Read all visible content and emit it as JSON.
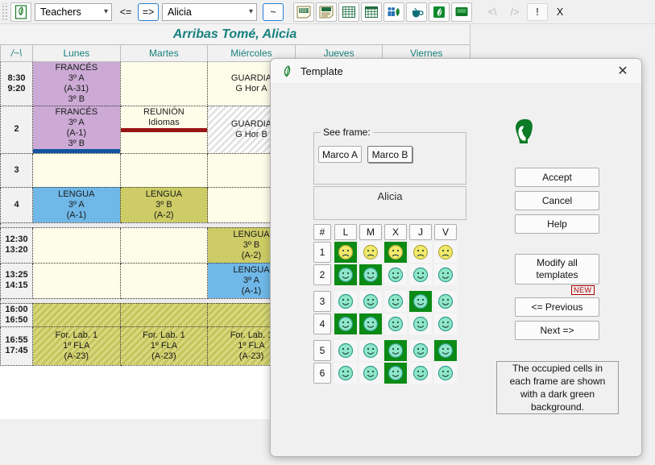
{
  "toolbar": {
    "app_icon": "leaf-door-icon",
    "entity_select": {
      "value": "Teachers",
      "icon": "chevron-down-icon"
    },
    "prev_label": "<=",
    "next_label": "=>",
    "person_select": {
      "value": "Alicia",
      "icon": "chevron-down-icon"
    },
    "tilde_label": "~",
    "view_buttons": [
      {
        "name": "timetable-card-icon"
      },
      {
        "name": "timetable-lined-icon"
      },
      {
        "name": "grid-view-icon"
      },
      {
        "name": "grid-columns-icon"
      },
      {
        "name": "people-leaf-icon"
      },
      {
        "name": "cup-icon"
      },
      {
        "name": "leaf-icon"
      },
      {
        "name": "chalkboard-icon"
      }
    ],
    "tail_buttons": [
      {
        "label": "<\\",
        "dim": true
      },
      {
        "label": "/>",
        "dim": true
      },
      {
        "label": "!",
        "dim": false
      },
      {
        "label": "X",
        "dim": false
      }
    ]
  },
  "timetable": {
    "title": "Arribas Tomé, Alicia",
    "corner_label": "/~\\",
    "days": [
      "Lunes",
      "Martes",
      "Miércoles",
      "Jueves",
      "Viernes"
    ],
    "rows": [
      {
        "time": [
          "8:30",
          "9:20"
        ],
        "cells": [
          {
            "style": "c-purple",
            "lines": [
              "FRANCÉS",
              "3º A",
              "(A-31)",
              "3º B"
            ]
          },
          {
            "style": "c-cream",
            "lines": []
          },
          {
            "style": "c-cream",
            "lines": [
              "GUARDIA",
              "G Hor A"
            ]
          },
          {
            "style": "c-cream",
            "lines": []
          },
          {
            "style": "c-cream",
            "lines": []
          }
        ]
      },
      {
        "time": [
          "2"
        ],
        "cells": [
          {
            "style": "c-purple",
            "lines": [
              "FRANCÉS",
              "3º A",
              "(A-1)",
              "3º B"
            ],
            "bar": "blue"
          },
          {
            "style": "c-cream",
            "lines": [
              "REUNIÓN",
              "Idiomas"
            ],
            "bar": "red"
          },
          {
            "style": "hatch-grey",
            "lines": [
              "GUARDIA",
              "G Hor B"
            ]
          },
          {
            "style": "c-cream",
            "lines": []
          },
          {
            "style": "c-cream",
            "lines": []
          }
        ]
      },
      {
        "time": [
          "3"
        ],
        "cells": [
          {
            "style": "c-cream",
            "lines": []
          },
          {
            "style": "c-cream",
            "lines": []
          },
          {
            "style": "c-cream",
            "lines": []
          },
          {
            "style": "c-cream",
            "lines": []
          },
          {
            "style": "c-cream",
            "lines": []
          }
        ]
      },
      {
        "time": [
          "4"
        ],
        "cells": [
          {
            "style": "c-blue",
            "lines": [
              "LENGUA",
              "3º A",
              "(A-1)"
            ]
          },
          {
            "style": "c-olive",
            "lines": [
              "LENGUA",
              "3º B",
              "(A-2)"
            ]
          },
          {
            "style": "c-cream",
            "lines": []
          },
          {
            "style": "c-cream",
            "lines": []
          },
          {
            "style": "c-cream",
            "lines": []
          }
        ]
      },
      {
        "time": [
          "12:30",
          "13:20"
        ],
        "cells": [
          {
            "style": "c-cream",
            "lines": []
          },
          {
            "style": "c-cream",
            "lines": []
          },
          {
            "style": "c-olive",
            "lines": [
              "LENGUA",
              "3º B",
              "(A-2)"
            ]
          },
          {
            "style": "c-cream",
            "lines": []
          },
          {
            "style": "c-cream",
            "lines": []
          }
        ]
      },
      {
        "time": [
          "13:25",
          "14:15"
        ],
        "cells": [
          {
            "style": "c-cream",
            "lines": []
          },
          {
            "style": "c-cream",
            "lines": []
          },
          {
            "style": "c-blue",
            "lines": [
              "LENGUA",
              "3º A",
              "(A-1)"
            ]
          },
          {
            "style": "c-cream",
            "lines": []
          },
          {
            "style": "c-cream",
            "lines": []
          }
        ]
      },
      {
        "time": [
          "16:00",
          "16:50"
        ],
        "cells": [
          {
            "style": "hatch-olive",
            "lines": []
          },
          {
            "style": "hatch-olive",
            "lines": []
          },
          {
            "style": "hatch-olive",
            "lines": []
          },
          {
            "style": "hatch-olive",
            "lines": []
          },
          {
            "style": "hatch-olive",
            "lines": []
          }
        ]
      },
      {
        "time": [
          "16:55",
          "17:45"
        ],
        "cells": [
          {
            "style": "hatch-olive",
            "lines": [
              "For. Lab. 1",
              "1º FLA",
              "(A-23)"
            ]
          },
          {
            "style": "hatch-olive",
            "lines": [
              "For. Lab. 1",
              "1º FLA",
              "(A-23)"
            ]
          },
          {
            "style": "hatch-olive",
            "lines": [
              "For. Lab. 1",
              "1º FLA",
              "(A-23)"
            ]
          },
          {
            "style": "hatch-olive",
            "lines": []
          },
          {
            "style": "hatch-olive",
            "lines": []
          }
        ]
      }
    ]
  },
  "dialog": {
    "title": "Template",
    "title_icon": "leaf-icon",
    "close_icon": "close-icon",
    "frame_group_label": "See frame:",
    "frame_buttons": [
      {
        "label": "Marco A",
        "selected": true
      },
      {
        "label": "Marco B",
        "selected": false
      }
    ],
    "name_display": "Alicia",
    "head_icon": "person-head-icon",
    "buttons": {
      "accept": "Accept",
      "cancel": "Cancel",
      "help": "Help",
      "modify_all": "Modify all templates",
      "new_badge": "NEW",
      "previous": "<= Previous",
      "next": "Next =>"
    },
    "note": "The occupied cells in each frame are shown with a dark green background.",
    "grid": {
      "corner": "#",
      "columns": [
        "L",
        "M",
        "X",
        "J",
        "V"
      ],
      "rows": [
        {
          "num": "1",
          "face": "frown-yellow",
          "occupied": [
            true,
            false,
            true,
            false,
            false
          ]
        },
        {
          "num": "2",
          "face": "smile-cyan",
          "occupied": [
            true,
            true,
            false,
            false,
            false
          ]
        },
        {
          "num": "3",
          "face": "smile-cyan",
          "occupied": [
            false,
            false,
            false,
            true,
            false
          ]
        },
        {
          "num": "4",
          "face": "smile-cyan",
          "occupied": [
            true,
            true,
            false,
            false,
            false
          ]
        },
        {
          "num": "5",
          "face": "smile-cyan",
          "occupied": [
            false,
            false,
            true,
            false,
            true
          ]
        },
        {
          "num": "6",
          "face": "smile-cyan",
          "occupied": [
            false,
            false,
            true,
            false,
            false
          ]
        }
      ]
    }
  },
  "colors": {
    "teal_title": "#17807d",
    "purple_cell": "#ccaad5",
    "blue_cell": "#6fb8e8",
    "olive_cell": "#cdcc66",
    "cream_cell": "#fdfde9",
    "dark_green": "#0b8a14",
    "bar_blue": "#1254a0",
    "bar_red": "#9a1414"
  }
}
